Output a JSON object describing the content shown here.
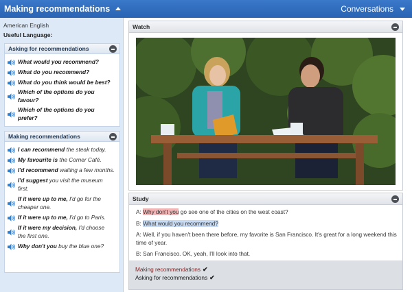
{
  "header": {
    "title": "Making recommendations",
    "right_label": "Conversations"
  },
  "sidebar": {
    "variant": "American English",
    "useful_heading": "Useful Language:",
    "sections": [
      {
        "title": "Asking for recommendations",
        "phrases": [
          {
            "bold": "What would you recommend?",
            "rest": ""
          },
          {
            "bold": "What do you recommend?",
            "rest": ""
          },
          {
            "bold": "What do you think would be best?",
            "rest": ""
          },
          {
            "bold": "Which of the options do you favour?",
            "rest": ""
          },
          {
            "bold": "Which of the options do you prefer?",
            "rest": ""
          }
        ]
      },
      {
        "title": "Making recommendations",
        "phrases": [
          {
            "bold": "I can recommend",
            "rest": "the steak today."
          },
          {
            "bold": "My favourite is",
            "rest": "the Corner Café."
          },
          {
            "bold": "I'd recommend",
            "rest": "waiting a few months."
          },
          {
            "bold": "I'd suggest",
            "rest": "you visit the museum first."
          },
          {
            "bold": "If it were up to me,",
            "rest": "I'd go for the cheaper one."
          },
          {
            "bold": "If it were up to me,",
            "rest": "I'd go to Paris."
          },
          {
            "bold": "If it were my decision,",
            "rest": "I'd choose the first one."
          },
          {
            "bold": "Why don't you",
            "rest": "buy the blue one?"
          }
        ]
      }
    ]
  },
  "watch": {
    "title": "Watch"
  },
  "study": {
    "title": "Study",
    "lines": [
      {
        "speaker": "A:",
        "highlight": "Why don't you",
        "rest": "go see one of the cities on the west coast?"
      },
      {
        "speaker": "B:",
        "highlight": "What would you recommend?",
        "rest": ""
      },
      {
        "speaker": "A:",
        "highlight": "",
        "rest": "Well, if you haven't been there before, my favorite is San Francisco. It's great for a long weekend this time of year."
      },
      {
        "speaker": "B:",
        "highlight": "",
        "rest": "San Francisco. OK, yeah, I'll look into that."
      }
    ],
    "checklist": [
      {
        "label": "Making recommendations",
        "check": "✔"
      },
      {
        "label": "Asking for recommendations",
        "check": "✔"
      }
    ]
  },
  "colors": {
    "header_blue": "#2f6bbd",
    "sidebar_bg": "#dde9f6",
    "speaker_icon": "#2c7fd1",
    "highlight_red": "#f3b6b6",
    "highlight_blue": "#c7dbf5"
  }
}
